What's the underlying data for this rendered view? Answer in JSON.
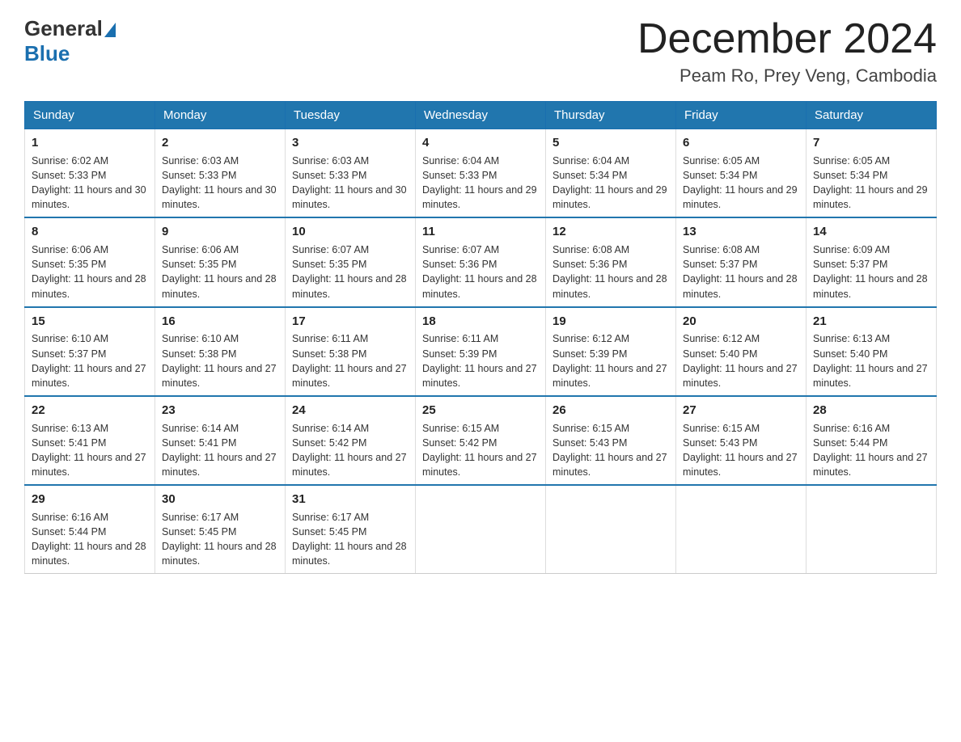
{
  "header": {
    "logo_general": "General",
    "logo_blue": "Blue",
    "month_title": "December 2024",
    "subtitle": "Peam Ro, Prey Veng, Cambodia"
  },
  "days_of_week": [
    "Sunday",
    "Monday",
    "Tuesday",
    "Wednesday",
    "Thursday",
    "Friday",
    "Saturday"
  ],
  "weeks": [
    [
      {
        "day": "1",
        "sunrise": "6:02 AM",
        "sunset": "5:33 PM",
        "daylight": "11 hours and 30 minutes."
      },
      {
        "day": "2",
        "sunrise": "6:03 AM",
        "sunset": "5:33 PM",
        "daylight": "11 hours and 30 minutes."
      },
      {
        "day": "3",
        "sunrise": "6:03 AM",
        "sunset": "5:33 PM",
        "daylight": "11 hours and 30 minutes."
      },
      {
        "day": "4",
        "sunrise": "6:04 AM",
        "sunset": "5:33 PM",
        "daylight": "11 hours and 29 minutes."
      },
      {
        "day": "5",
        "sunrise": "6:04 AM",
        "sunset": "5:34 PM",
        "daylight": "11 hours and 29 minutes."
      },
      {
        "day": "6",
        "sunrise": "6:05 AM",
        "sunset": "5:34 PM",
        "daylight": "11 hours and 29 minutes."
      },
      {
        "day": "7",
        "sunrise": "6:05 AM",
        "sunset": "5:34 PM",
        "daylight": "11 hours and 29 minutes."
      }
    ],
    [
      {
        "day": "8",
        "sunrise": "6:06 AM",
        "sunset": "5:35 PM",
        "daylight": "11 hours and 28 minutes."
      },
      {
        "day": "9",
        "sunrise": "6:06 AM",
        "sunset": "5:35 PM",
        "daylight": "11 hours and 28 minutes."
      },
      {
        "day": "10",
        "sunrise": "6:07 AM",
        "sunset": "5:35 PM",
        "daylight": "11 hours and 28 minutes."
      },
      {
        "day": "11",
        "sunrise": "6:07 AM",
        "sunset": "5:36 PM",
        "daylight": "11 hours and 28 minutes."
      },
      {
        "day": "12",
        "sunrise": "6:08 AM",
        "sunset": "5:36 PM",
        "daylight": "11 hours and 28 minutes."
      },
      {
        "day": "13",
        "sunrise": "6:08 AM",
        "sunset": "5:37 PM",
        "daylight": "11 hours and 28 minutes."
      },
      {
        "day": "14",
        "sunrise": "6:09 AM",
        "sunset": "5:37 PM",
        "daylight": "11 hours and 28 minutes."
      }
    ],
    [
      {
        "day": "15",
        "sunrise": "6:10 AM",
        "sunset": "5:37 PM",
        "daylight": "11 hours and 27 minutes."
      },
      {
        "day": "16",
        "sunrise": "6:10 AM",
        "sunset": "5:38 PM",
        "daylight": "11 hours and 27 minutes."
      },
      {
        "day": "17",
        "sunrise": "6:11 AM",
        "sunset": "5:38 PM",
        "daylight": "11 hours and 27 minutes."
      },
      {
        "day": "18",
        "sunrise": "6:11 AM",
        "sunset": "5:39 PM",
        "daylight": "11 hours and 27 minutes."
      },
      {
        "day": "19",
        "sunrise": "6:12 AM",
        "sunset": "5:39 PM",
        "daylight": "11 hours and 27 minutes."
      },
      {
        "day": "20",
        "sunrise": "6:12 AM",
        "sunset": "5:40 PM",
        "daylight": "11 hours and 27 minutes."
      },
      {
        "day": "21",
        "sunrise": "6:13 AM",
        "sunset": "5:40 PM",
        "daylight": "11 hours and 27 minutes."
      }
    ],
    [
      {
        "day": "22",
        "sunrise": "6:13 AM",
        "sunset": "5:41 PM",
        "daylight": "11 hours and 27 minutes."
      },
      {
        "day": "23",
        "sunrise": "6:14 AM",
        "sunset": "5:41 PM",
        "daylight": "11 hours and 27 minutes."
      },
      {
        "day": "24",
        "sunrise": "6:14 AM",
        "sunset": "5:42 PM",
        "daylight": "11 hours and 27 minutes."
      },
      {
        "day": "25",
        "sunrise": "6:15 AM",
        "sunset": "5:42 PM",
        "daylight": "11 hours and 27 minutes."
      },
      {
        "day": "26",
        "sunrise": "6:15 AM",
        "sunset": "5:43 PM",
        "daylight": "11 hours and 27 minutes."
      },
      {
        "day": "27",
        "sunrise": "6:15 AM",
        "sunset": "5:43 PM",
        "daylight": "11 hours and 27 minutes."
      },
      {
        "day": "28",
        "sunrise": "6:16 AM",
        "sunset": "5:44 PM",
        "daylight": "11 hours and 27 minutes."
      }
    ],
    [
      {
        "day": "29",
        "sunrise": "6:16 AM",
        "sunset": "5:44 PM",
        "daylight": "11 hours and 28 minutes."
      },
      {
        "day": "30",
        "sunrise": "6:17 AM",
        "sunset": "5:45 PM",
        "daylight": "11 hours and 28 minutes."
      },
      {
        "day": "31",
        "sunrise": "6:17 AM",
        "sunset": "5:45 PM",
        "daylight": "11 hours and 28 minutes."
      },
      null,
      null,
      null,
      null
    ]
  ],
  "labels": {
    "sunrise_prefix": "Sunrise: ",
    "sunset_prefix": "Sunset: ",
    "daylight_prefix": "Daylight: "
  }
}
